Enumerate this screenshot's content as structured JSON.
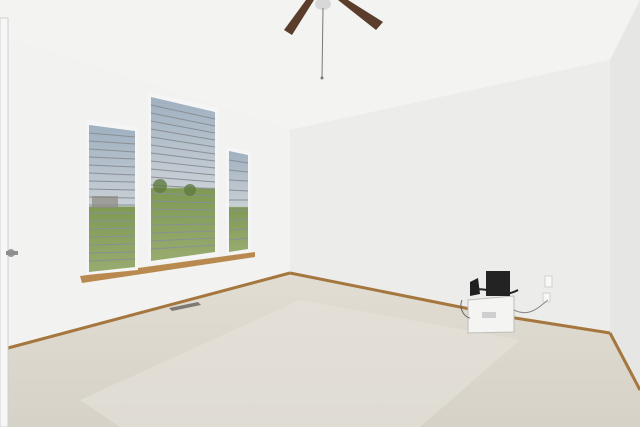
{
  "scene": {
    "subject": "empty-room-interior",
    "colors": {
      "wall_left": "#f1f1f0",
      "wall_back": "#ececeb",
      "ceiling": "#f3f3f2",
      "carpet": "#dcd8ce",
      "baseboard": "#a5773f",
      "window_sill": "#b98a4f",
      "lawn": "#8da261",
      "fan_blade": "#5a3d2b"
    },
    "objects": [
      "ceiling-fan",
      "window-left",
      "window-center",
      "window-right",
      "door-edge",
      "door-handle",
      "floor-vent",
      "storage-bin",
      "electrical-outlet"
    ]
  }
}
